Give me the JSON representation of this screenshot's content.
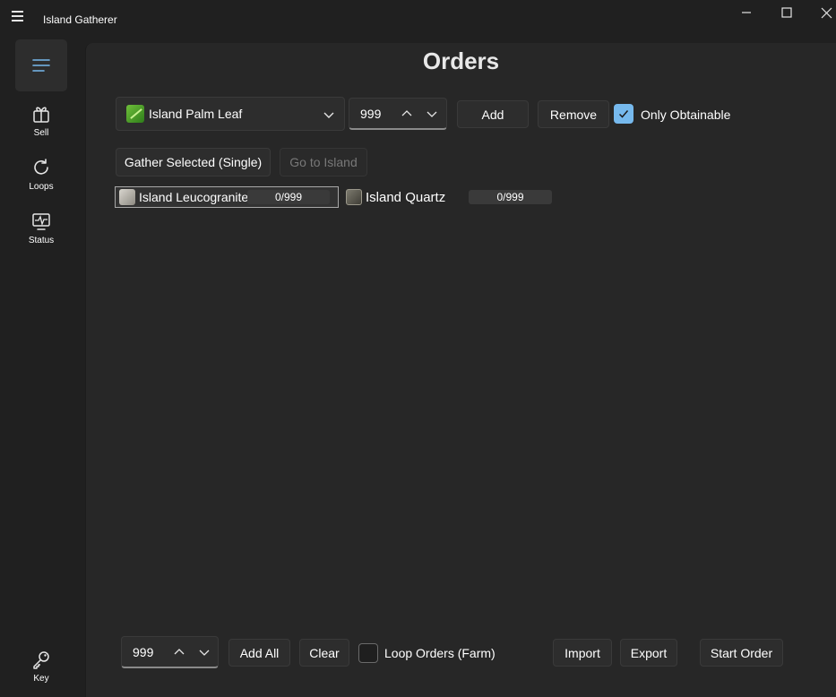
{
  "app": {
    "title": "Island Gatherer"
  },
  "nav": {
    "items": [
      {
        "label": "Sell"
      },
      {
        "label": "Loops"
      },
      {
        "label": "Status"
      },
      {
        "label": "Key"
      }
    ]
  },
  "page": {
    "title": "Orders"
  },
  "top_controls": {
    "selected_item": "Island Palm Leaf",
    "quantity": "999",
    "add_label": "Add",
    "remove_label": "Remove",
    "only_obtainable_label": "Only Obtainable",
    "only_obtainable_checked": true,
    "gather_selected_label": "Gather Selected (Single)",
    "go_to_island_label": "Go to Island"
  },
  "orders": [
    {
      "name": "Island Leucogranite",
      "progress": "0/999",
      "selected": true
    },
    {
      "name": "Island Quartz",
      "progress": "0/999",
      "selected": false
    }
  ],
  "bottom_controls": {
    "quantity": "999",
    "add_all_label": "Add All",
    "clear_label": "Clear",
    "loop_orders_label": "Loop Orders (Farm)",
    "loop_orders_checked": false,
    "import_label": "Import",
    "export_label": "Export",
    "start_order_label": "Start Order"
  },
  "colors": {
    "accent": "#76b9ed",
    "window_bg": "#202020",
    "content_bg": "#272727"
  }
}
